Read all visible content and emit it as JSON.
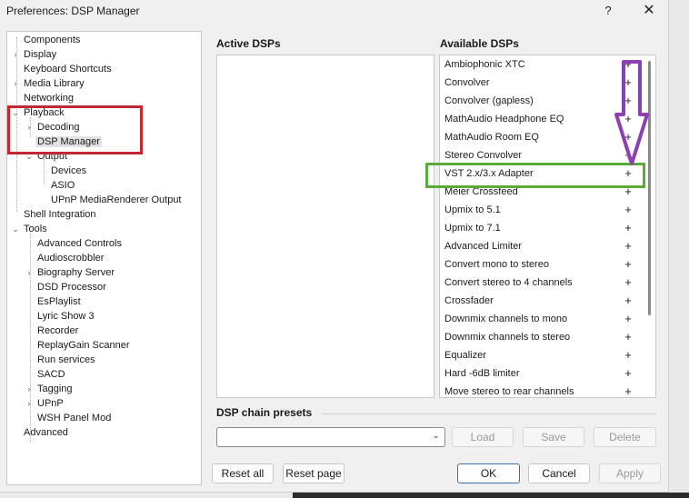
{
  "window": {
    "title": "Preferences: DSP Manager",
    "help_glyph": "?",
    "close_glyph": "✕"
  },
  "tree": {
    "items": [
      {
        "label": "Components",
        "expander": ""
      },
      {
        "label": "Display",
        "expander": "›"
      },
      {
        "label": "Keyboard Shortcuts",
        "expander": ""
      },
      {
        "label": "Media Library",
        "expander": "›"
      },
      {
        "label": "Networking",
        "expander": ""
      },
      {
        "label": "Playback",
        "expander": "⌄"
      },
      {
        "label": "Decoding",
        "expander": "›"
      },
      {
        "label": "DSP Manager",
        "expander": ""
      },
      {
        "label": "Output",
        "expander": "⌄"
      },
      {
        "label": "Devices",
        "expander": ""
      },
      {
        "label": "ASIO",
        "expander": ""
      },
      {
        "label": "UPnP MediaRenderer Output",
        "expander": ""
      },
      {
        "label": "Shell Integration",
        "expander": ""
      },
      {
        "label": "Tools",
        "expander": "⌄"
      },
      {
        "label": "Advanced Controls",
        "expander": ""
      },
      {
        "label": "Audioscrobbler",
        "expander": ""
      },
      {
        "label": "Biography Server",
        "expander": "›"
      },
      {
        "label": "DSD Processor",
        "expander": ""
      },
      {
        "label": "EsPlaylist",
        "expander": ""
      },
      {
        "label": "Lyric Show 3",
        "expander": ""
      },
      {
        "label": "Recorder",
        "expander": ""
      },
      {
        "label": "ReplayGain Scanner",
        "expander": ""
      },
      {
        "label": "Run services",
        "expander": ""
      },
      {
        "label": "SACD",
        "expander": ""
      },
      {
        "label": "Tagging",
        "expander": "›"
      },
      {
        "label": "UPnP",
        "expander": "›"
      },
      {
        "label": "WSH Panel Mod",
        "expander": ""
      },
      {
        "label": "Advanced",
        "expander": ""
      }
    ]
  },
  "active_dsps": {
    "title": "Active DSPs"
  },
  "available_dsps": {
    "title": "Available DSPs",
    "add_glyph": "+",
    "items": [
      "Ambiophonic XTC",
      "Convolver",
      "Convolver (gapless)",
      "MathAudio Headphone EQ",
      "MathAudio Room EQ",
      "Stereo Convolver",
      "VST 2.x/3.x Adapter",
      "Meier Crossfeed",
      "Upmix to 5.1",
      "Upmix to 7.1",
      "Advanced Limiter",
      "Convert mono to stereo",
      "Convert stereo to 4 channels",
      "Crossfader",
      "Downmix channels to mono",
      "Downmix channels to stereo",
      "Equalizer",
      "Hard -6dB limiter",
      "Move stereo to rear channels"
    ]
  },
  "presets": {
    "title": "DSP chain presets",
    "combo_value": "",
    "chevron": "⌄",
    "load_label": "Load",
    "save_label": "Save",
    "delete_label": "Delete"
  },
  "footer": {
    "reset_all_label": "Reset all",
    "reset_page_label": "Reset page",
    "ok_label": "OK",
    "cancel_label": "Cancel",
    "apply_label": "Apply"
  },
  "annotations": {
    "red": "#c4272f",
    "green": "#5bab3b",
    "purple": "#8b3fb0"
  }
}
